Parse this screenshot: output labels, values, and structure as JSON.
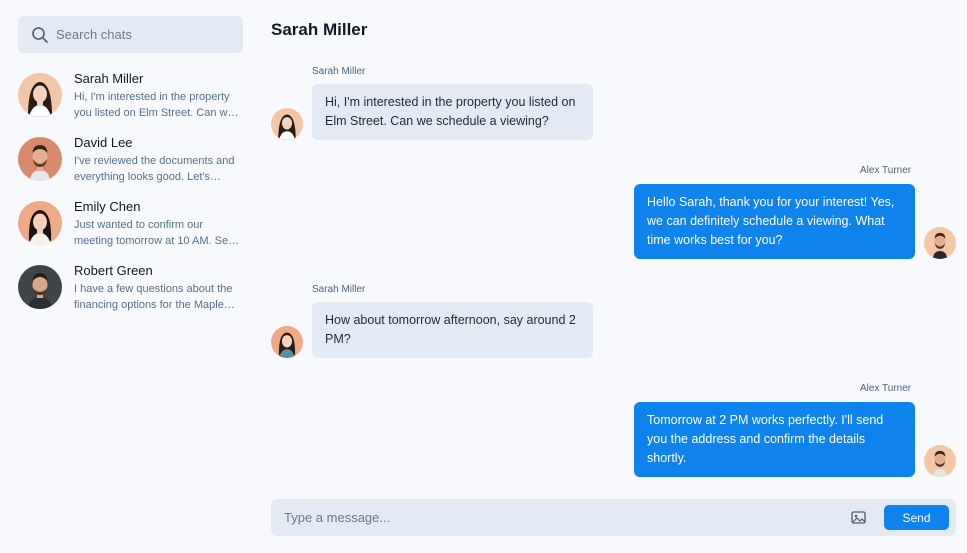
{
  "search": {
    "placeholder": "Search chats",
    "icon": "search-icon"
  },
  "conversations": [
    {
      "name": "Sarah Miller",
      "preview": "Hi, I'm interested in the property you listed on Elm Street. Can we schedule a viewing?",
      "avatar_bg": "#f2c6a8",
      "skin": "#f5d2bc",
      "hair": "#2a1b14"
    },
    {
      "name": "David Lee",
      "preview": "I've reviewed the documents and everything looks good. Let's proceed.",
      "avatar_bg": "#d98a6c",
      "skin": "#e2b08f",
      "hair": "#3a2418"
    },
    {
      "name": "Emily Chen",
      "preview": "Just wanted to confirm our meeting tomorrow at 10 AM. See you then.",
      "avatar_bg": "#f0a987",
      "skin": "#f5d0bb",
      "hair": "#1c1410"
    },
    {
      "name": "Robert Green",
      "preview": "I have a few questions about the financing options for the Maple property.",
      "avatar_bg": "#3f4448",
      "skin": "#d7a887",
      "hair": "#251a14"
    }
  ],
  "chat": {
    "title": "Sarah Miller",
    "messages": [
      {
        "sender": "Sarah Miller",
        "direction": "incoming",
        "text": "Hi, I'm interested in the property you listed on Elm Street. Can we schedule a viewing?"
      },
      {
        "sender": "Alex Turner",
        "direction": "outgoing",
        "text": "Hello Sarah, thank you for your interest! Yes, we can definitely schedule a viewing. What time works best for you?"
      },
      {
        "sender": "Sarah Miller",
        "direction": "incoming",
        "text": "How about tomorrow afternoon, say around 2 PM?"
      },
      {
        "sender": "Alex Turner",
        "direction": "outgoing",
        "text": "Tomorrow at 2 PM works perfectly. I'll send you the address and confirm the details shortly."
      }
    ]
  },
  "composer": {
    "placeholder": "Type a message...",
    "attach_icon": "image-icon",
    "send_label": "Send"
  },
  "colors": {
    "accent": "#0f83ec",
    "incoming_bubble": "#e3eaf3",
    "panel_bg": "#f7f9fc"
  }
}
